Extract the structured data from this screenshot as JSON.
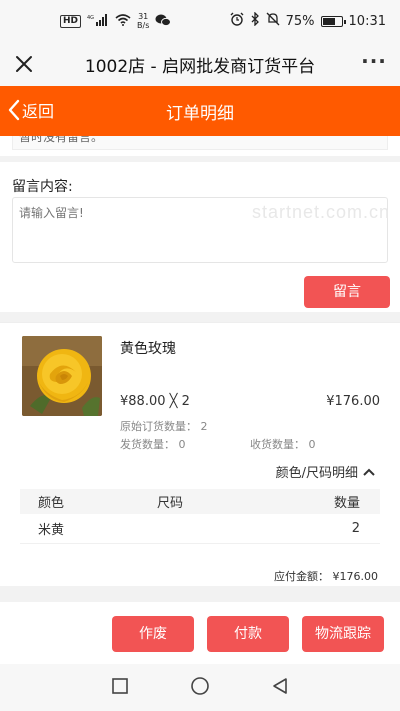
{
  "statusbar": {
    "hd_badge": "HD",
    "network_tag": "4G",
    "speed_value": "31",
    "speed_unit": "B/s",
    "battery_percent": "75%",
    "battery_level": 0.75,
    "time": "10:31"
  },
  "titlebar": {
    "title": "1002店 - 启网批发商订货平台",
    "more_label": "···"
  },
  "navbar": {
    "back_label": "返回",
    "title": "订单明细"
  },
  "message": {
    "previous_text": "暂时没有留言。",
    "label": "留言内容:",
    "placeholder": "请输入留言!",
    "watermark": "startnet.com.cn",
    "submit_label": "留言"
  },
  "product": {
    "name": "黄色玫瑰",
    "price_qty": "¥88.00 ╳ 2",
    "subtotal": "¥176.00",
    "original_qty": "原始订货数量： 2",
    "shipped_qty": "发货数量： 0",
    "received_qty": "收货数量： 0",
    "detail_toggle_label": "颜色/尺码明细"
  },
  "sku_table": {
    "headers": [
      "颜色",
      "尺码",
      "数量"
    ],
    "rows": [
      [
        "米黄",
        "",
        "2"
      ]
    ]
  },
  "payable": "应付金额： ¥176.00",
  "actions": {
    "void_label": "作废",
    "pay_label": "付款",
    "logistics_label": "物流跟踪"
  },
  "colors": {
    "brand_orange": "#ff5a00",
    "action_red": "#f25454"
  }
}
